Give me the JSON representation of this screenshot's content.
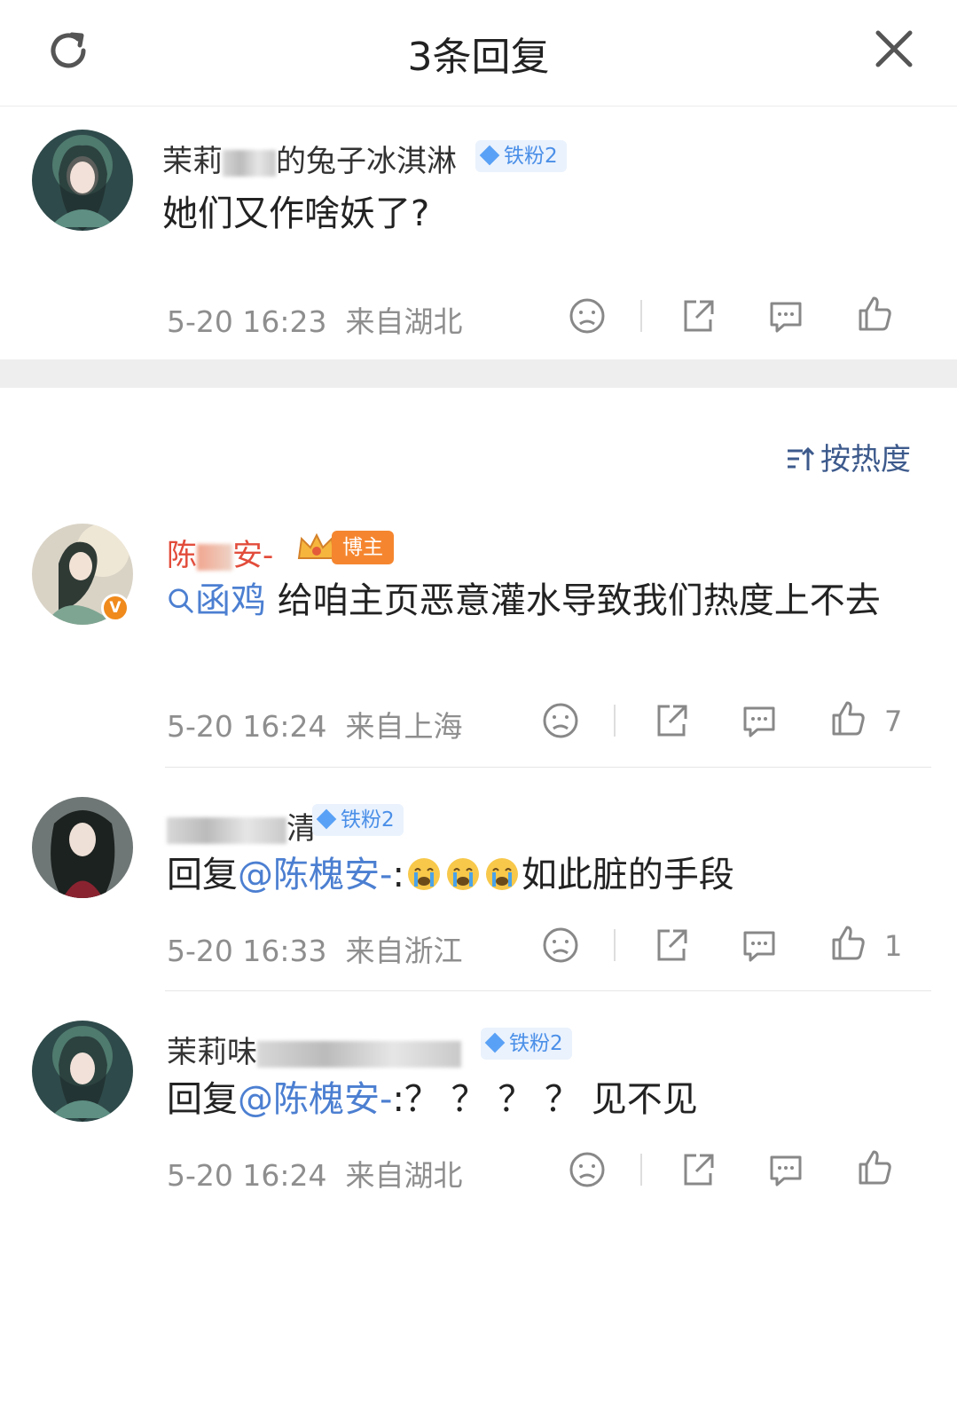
{
  "header": {
    "title": "3条回复"
  },
  "main_comment": {
    "user_visible": "茉莉",
    "user_tail": "的兔子冰淇淋",
    "fan_badge": "铁粉2",
    "text": "她们又作啥妖了?",
    "time": "5-20 16:23",
    "location": "来自湖北"
  },
  "sort": {
    "label": "按热度"
  },
  "replies": [
    {
      "user_visible": "陈",
      "user_tail": "安-",
      "badge": "博主",
      "search_keyword": "函鸡",
      "text": "给咱主页恶意灌水导致我们热度上不去",
      "time": "5-20 16:24",
      "location": "来自上海",
      "likes": "7"
    },
    {
      "user_visible": "",
      "user_tail": "清",
      "fan_badge": "铁粉2",
      "reply_prefix": "回复",
      "mention": "@陈槐安-",
      "colon": ":",
      "text": "如此脏的手段",
      "time": "5-20 16:33",
      "location": "来自浙江",
      "likes": "1"
    },
    {
      "user_visible": "茉莉味",
      "user_tail": "",
      "fan_badge": "铁粉2",
      "reply_prefix": "回复",
      "mention": "@陈槐安-",
      "text": ":？ ？ ？ ？ 见不见",
      "time": "5-20 16:24",
      "location": "来自湖北"
    }
  ],
  "colors": {
    "link": "#4c7fd1",
    "meta": "#8e8e8e",
    "fan_badge": "#4a8fe8",
    "blogger_badge": "#f5862f"
  },
  "icons": [
    "refresh-icon",
    "close-icon",
    "dislike-icon",
    "share-icon",
    "comment-icon",
    "like-icon",
    "sort-icon",
    "search-icon",
    "crying-emoji"
  ]
}
